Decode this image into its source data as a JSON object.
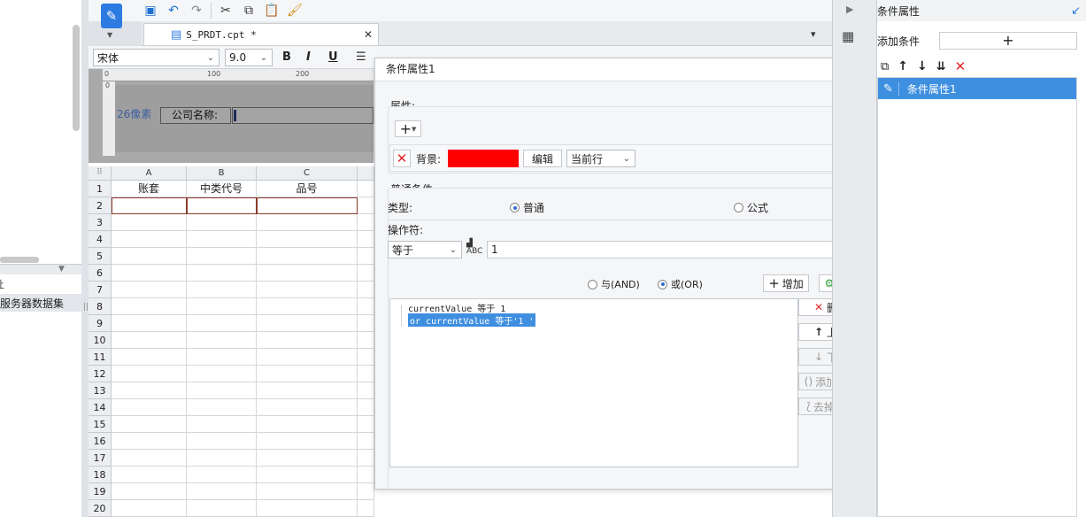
{
  "left_panel": {
    "item_1": "让",
    "item_2": "服务器数据集",
    "grip": "||"
  },
  "tab": {
    "filename": "S_PRDT.cpt *",
    "close": "✕"
  },
  "format": {
    "font": "宋体",
    "size": "9.0",
    "bold": "B",
    "italic": "I",
    "underline": "U"
  },
  "ruler": {
    "t0": "0",
    "t100": "100",
    "t200": "200",
    "v0": "0"
  },
  "parameter_pane": {
    "size_label": "26像素",
    "company_label": "公司名称:"
  },
  "sheet": {
    "columns": [
      "A",
      "B",
      "C"
    ],
    "rows": [
      "1",
      "2",
      "3",
      "4",
      "5",
      "6",
      "7",
      "8",
      "9",
      "10",
      "11",
      "12",
      "13",
      "14",
      "15",
      "16",
      "17",
      "18",
      "19",
      "20"
    ],
    "header_row": [
      "账套",
      "中类代号",
      "品号"
    ]
  },
  "dialog": {
    "title": "条件属性1",
    "property_section": "属性:",
    "add_symbol": "+",
    "background_label": "背景:",
    "background_color": "#ff0000",
    "edit_button": "编辑",
    "scope_select": "当前行",
    "normal_condition": "普通条件",
    "type_label": "类型:",
    "type_normal": "普通",
    "type_formula": "公式",
    "operator_label": "操作符:",
    "operator_value": "等于",
    "operand_value": "1",
    "and_label": "与(AND)",
    "or_label": "或(OR)",
    "add_button": "增加",
    "modify_button": "修改",
    "conditions": [
      "currentValue 等于 1",
      "or  currentValue 等于'1 '"
    ],
    "delete_button": "删除",
    "move_up_button": "上移",
    "move_down_button": "下移",
    "add_bracket_button": "添加括号",
    "remove_bracket_button": "去掉括号"
  },
  "right_panel": {
    "title": "条件属性",
    "add_condition_label": "添加条件",
    "add_symbol": "+",
    "list_item": "条件属性1"
  },
  "colors": {
    "accent": "#3f8fe0",
    "delete_red": "#e0262a",
    "selection": "#3f8fe0"
  }
}
